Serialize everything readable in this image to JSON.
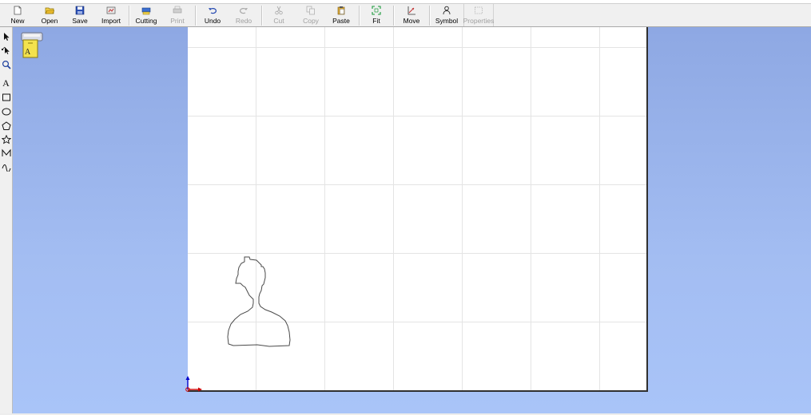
{
  "toolbar": {
    "new": "New",
    "open": "Open",
    "save": "Save",
    "import": "Import",
    "cutting": "Cutting",
    "print": "Print",
    "undo": "Undo",
    "redo": "Redo",
    "cut": "Cut",
    "copy": "Copy",
    "paste": "Paste",
    "fit": "Fit",
    "move": "Move",
    "symbol": "Symbol",
    "properties": "Properties"
  },
  "tools": {
    "text_glyph": "A"
  },
  "device_icon": {
    "label": "A"
  },
  "colors": {
    "workspace_top": "#8ea8e3",
    "workspace_bottom": "#a9c4f8",
    "axis_y": "#0000cc",
    "axis_x": "#cc0000"
  }
}
